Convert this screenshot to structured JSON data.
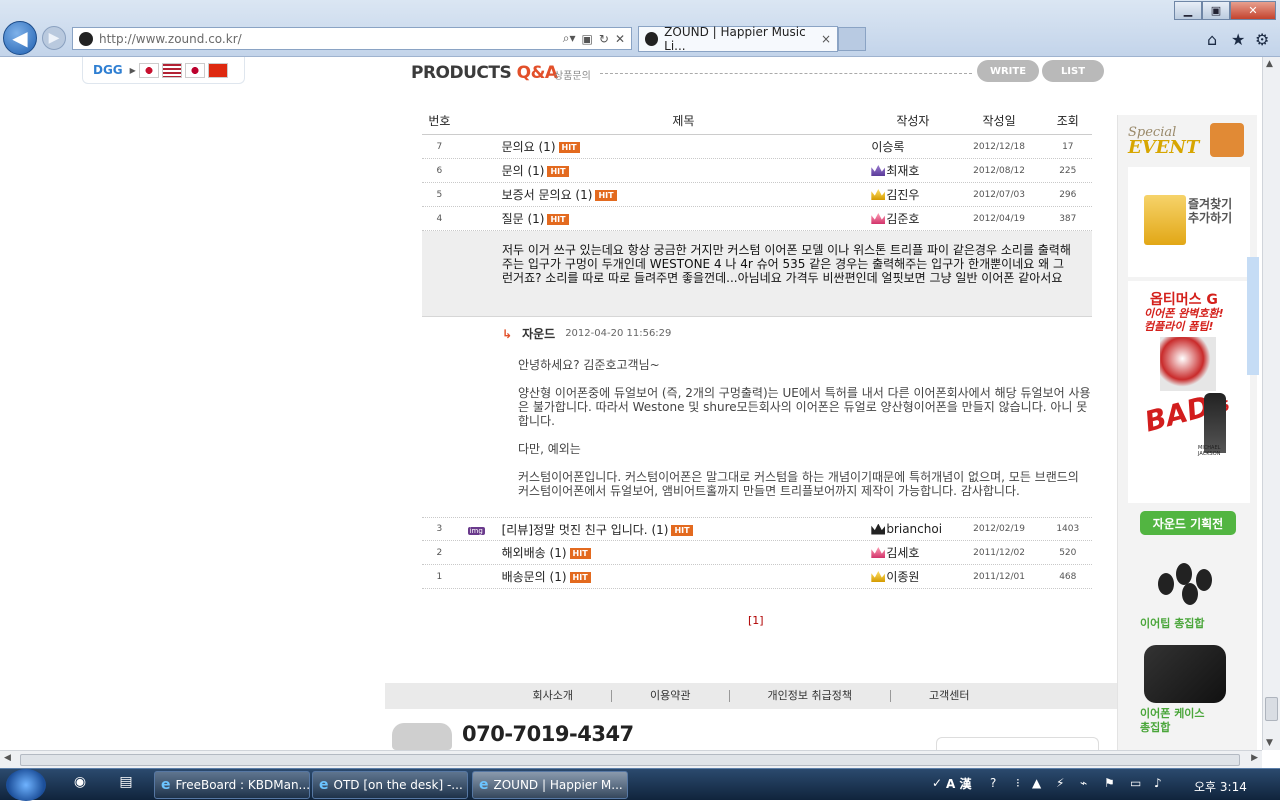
{
  "browser": {
    "url": "http://www.zound.co.kr/",
    "tab_title": "ZOUND | Happier Music Li...",
    "tab_close": "×"
  },
  "page": {
    "dgg_label": "DGG",
    "title_main": "PRODUCTS ",
    "title_accent": "Q&A",
    "subtitle": "상품문의",
    "write_button": "WRITE",
    "list_button": "LIST",
    "table_headers": {
      "no": "번호",
      "subject": "제목",
      "author": "작성자",
      "date": "작성일",
      "views": "조회"
    },
    "rows_top": [
      {
        "no": "7",
        "subject": "문의요 (1)",
        "author": "이승록",
        "date": "2012/12/18",
        "views": "17",
        "badge": "HIT"
      },
      {
        "no": "6",
        "subject": "문의 (1)",
        "author": "최재호",
        "date": "2012/08/12",
        "views": "225",
        "badge": "HIT"
      },
      {
        "no": "5",
        "subject": "보증서 문의요 (1)",
        "author": "김진우",
        "date": "2012/07/03",
        "views": "296",
        "badge": "HIT"
      },
      {
        "no": "4",
        "subject": "질문 (1)",
        "author": "김준호",
        "date": "2012/04/19",
        "views": "387",
        "badge": "HIT"
      }
    ],
    "question_body": "저두 이거 쓰구 있는데요 항상 궁금한 거지만 커스텀 이어폰 모델 이나 위스톤 트리플 파이 같은경우 소리를 출력해주는 입구가 구멍이 두개인데 WESTONE 4 나 4r 슈어 535 같은 경우는 출력해주는 입구가 한개뿐이네요 왜 그런거죠? 소리를 따로 따로 들려주면 좋을껀데...아님네요 가격두 비싼편인데 얼핏보면 그냥 일반 이어폰 같아서요",
    "reply": {
      "arrow": "↳",
      "author": "자운드",
      "date": "2012-04-20 11:56:29",
      "p1": "안녕하세요? 김준호고객님~",
      "p2": "양산형 이어폰중에 듀얼보어 (즉, 2개의 구멍출력)는 UE에서 특허를 내서 다른 이어폰회사에서 해당 듀얼보어 사용은 불가합니다. 따라서 Westone 및 shure모든회사의 이어폰은 듀얼로 양산형이어폰을 만들지 않습니다. 아니 못합니다.",
      "p3": "다만, 예외는",
      "p4": "커스텀이어폰입니다. 커스텀이어폰은 말그대로 커스텀을 하는 개념이기때문에 특허개념이 없으며, 모든 브랜드의 커스텀이어폰에서 듀얼보어, 앰비어트홀까지 만들면 트리플보어까지 제작이 가능합니다. 감사합니다."
    },
    "rows_bottom": [
      {
        "no": "3",
        "img": "img",
        "subject": "[리뷰]정말 멋진 친구 입니다. (1)",
        "author": "brianchoi",
        "date": "2012/02/19",
        "views": "1403",
        "badge": "HIT"
      },
      {
        "no": "2",
        "subject": "해외배송 (1)",
        "author": "김세호",
        "date": "2011/12/02",
        "views": "520",
        "badge": "HIT"
      },
      {
        "no": "1",
        "subject": "배송문의 (1)",
        "author": "이종원",
        "date": "2011/12/01",
        "views": "468",
        "badge": "HIT"
      }
    ],
    "pager": "[1]",
    "footer_links": [
      "회사소개",
      "이용약관",
      "개인정보 취급정책",
      "고객센터"
    ],
    "phone": "070-7019-4347"
  },
  "sidebar": {
    "event_top": "Special",
    "event_bottom": "EVENT",
    "fav_line1": "즐겨찾기",
    "fav_line2": "추가하기",
    "op_title": "옵티머스 G",
    "op_line1": "이어폰 완벽호환!",
    "op_line2": "컴플라이 폼팁!",
    "bad_text": "BAD",
    "bad_sub": "25",
    "mj_line1": "MICHAEL",
    "mj_line2": "JACKSON",
    "sound_button": "자운드 기획전",
    "tips_label": "이어팁 총집합",
    "case_line1": "이어폰 케이스",
    "case_line2": "총집합"
  },
  "taskbar": {
    "buttons": [
      "FreeBoard : KBDMan...",
      "OTD [on the desk] -...",
      "ZOUND | Happier M..."
    ],
    "ime": "A 漢",
    "clock": "오후 3:14"
  }
}
